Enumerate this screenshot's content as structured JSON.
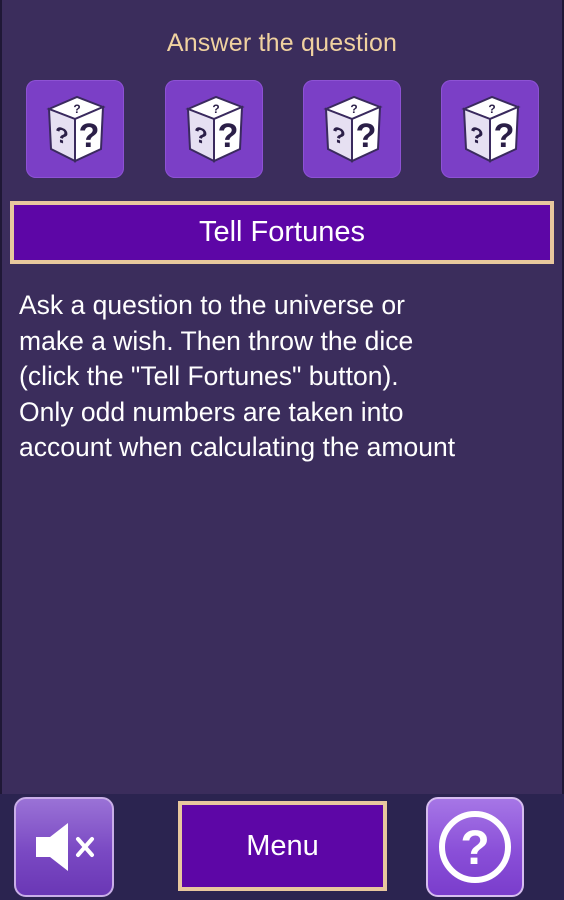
{
  "header": {
    "title": "Answer the question"
  },
  "dice": [
    {
      "icon": "question-die-icon",
      "face": "?"
    },
    {
      "icon": "question-die-icon",
      "face": "?"
    },
    {
      "icon": "question-die-icon",
      "face": "?"
    },
    {
      "icon": "question-die-icon",
      "face": "?"
    }
  ],
  "tell_button": {
    "label": "Tell Fortunes"
  },
  "description": {
    "line1": "Ask a question to the universe or",
    "line2": "make a wish. Then throw the dice",
    "line3": "(click the \"Tell Fortunes\" button).",
    "line4": "Only odd numbers are taken into",
    "line5": "account when calculating the amount"
  },
  "bottom_bar": {
    "sound_icon": "speaker-muted-icon",
    "menu_label": "Menu",
    "help_icon": "help-circle-icon",
    "help_glyph": "?"
  },
  "colors": {
    "background": "#3b2d5c",
    "accent_purple": "#5d06a6",
    "gold_border": "#e8c79e",
    "title_text": "#f0d2a0"
  }
}
